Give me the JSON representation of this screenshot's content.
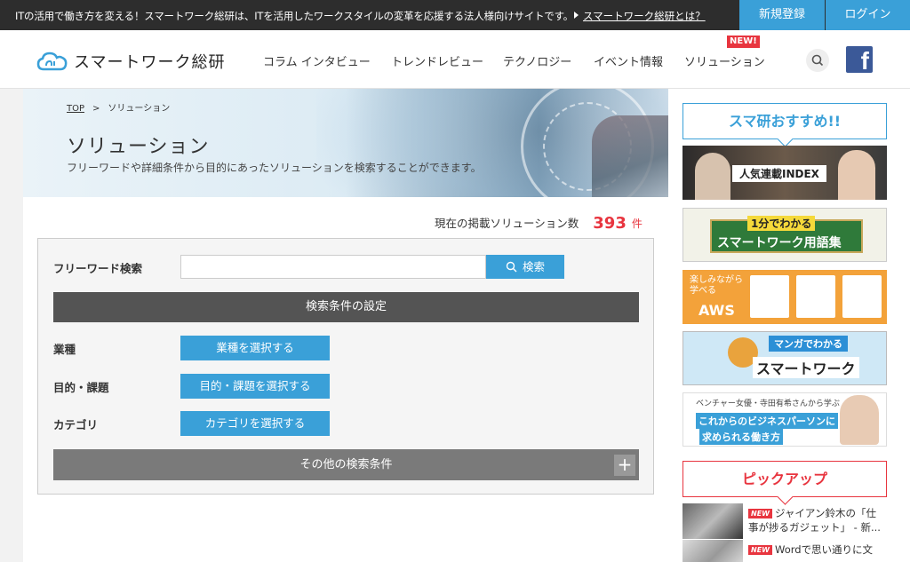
{
  "topbar": {
    "tagline": "ITの活用で働き方を変える！スマートワーク総研は、ITを活用したワークスタイルの変革を応援する法人様向けサイトです。",
    "about_link": "スマートワーク総研とは？",
    "register": "新規登録",
    "login": "ログイン"
  },
  "header": {
    "logo_text": "スマートワーク総研",
    "nav": [
      "コラム インタビュー",
      "トレンドレビュー",
      "テクノロジー",
      "イベント情報",
      "ソリューション"
    ],
    "new_badge": "NEW!",
    "fb_letter": "f"
  },
  "breadcrumb": {
    "top": "TOP",
    "sep": ">",
    "current": "ソリューション"
  },
  "hero": {
    "title": "ソリューション",
    "description": "フリーワードや詳細条件から目的にあったソリューションを検索することができます。"
  },
  "count": {
    "label": "現在の掲載ソリューション数",
    "value": "393",
    "unit": "件"
  },
  "search": {
    "keyword_label": "フリーワード検索",
    "keyword_value": "",
    "search_button": "検索",
    "conditions_header": "検索条件の設定",
    "industry_label": "業種",
    "industry_button": "業種を選択する",
    "purpose_label": "目的・課題",
    "purpose_button": "目的・課題を選択する",
    "category_label": "カテゴリ",
    "category_button": "カテゴリを選択する",
    "other_conditions": "その他の検索条件",
    "plus": "+"
  },
  "sidebar": {
    "recommend_title": "スマ研おすすめ!!",
    "banners": {
      "b1": "人気連載INDEX",
      "b2_line1": "1分でわかる",
      "b2_line2": "スマートワーク用語集",
      "b3_line1": "楽しみながら",
      "b3_line2": "学べる",
      "b3_line3": "AWS",
      "b4_line1": "マンガでわかる",
      "b4_line2": "スマートワーク",
      "b5_line1": "ベンチャー女優・寺田有希さんから学ぶ",
      "b5_line2": "これからのビジネスパーソンに",
      "b5_line3": "求められる働き方"
    },
    "pickup_title": "ピックアップ",
    "pickups": [
      {
        "badge": "NEW",
        "title": "ジャイアン鈴木の「仕",
        "title2": "事が捗るガジェット」 - 新..."
      },
      {
        "badge": "NEW",
        "title": "Wordで思い通りに文",
        "title2": ""
      }
    ]
  },
  "colors": {
    "accent": "#3aa0d8",
    "red": "#e8353f",
    "dark": "#2d2d2d"
  }
}
